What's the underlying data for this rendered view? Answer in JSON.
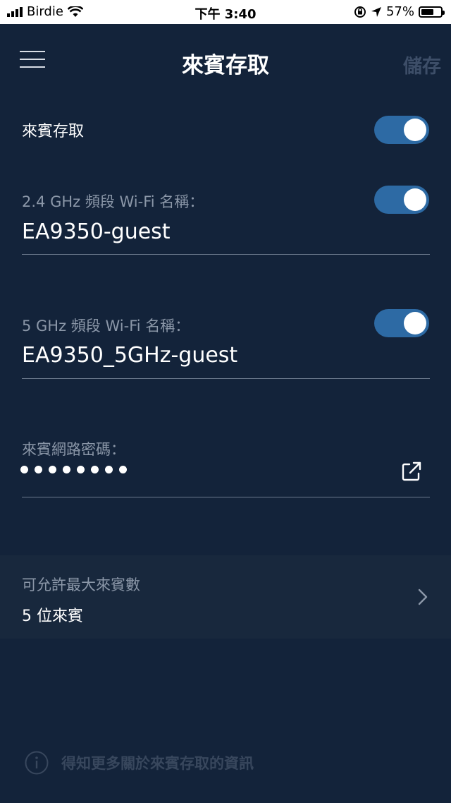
{
  "status_bar": {
    "carrier": "Birdie",
    "time": "下午 3:40",
    "battery": "57%"
  },
  "nav": {
    "title": "來賓存取",
    "save_label": "儲存"
  },
  "guest_access": {
    "label": "來賓存取",
    "enabled": true
  },
  "band_24": {
    "label": "2.4 GHz 頻段 Wi-Fi 名稱：",
    "value": "EA9350-guest",
    "enabled": true
  },
  "band_5": {
    "label": "5 GHz 頻段 Wi-Fi 名稱：",
    "value": "EA9350_5GHz-guest",
    "enabled": true
  },
  "password": {
    "label": "來賓網路密碼：",
    "masked_length": 8
  },
  "max_guests": {
    "label": "可允許最大來賓數",
    "value": "5 位來賓"
  },
  "info": {
    "text": "得知更多關於來賓存取的資訊"
  },
  "colors": {
    "background": "#13233a",
    "toggle_on": "#2d6aa4",
    "muted_text": "#8b97a8",
    "save_disabled": "#3d4e68"
  }
}
